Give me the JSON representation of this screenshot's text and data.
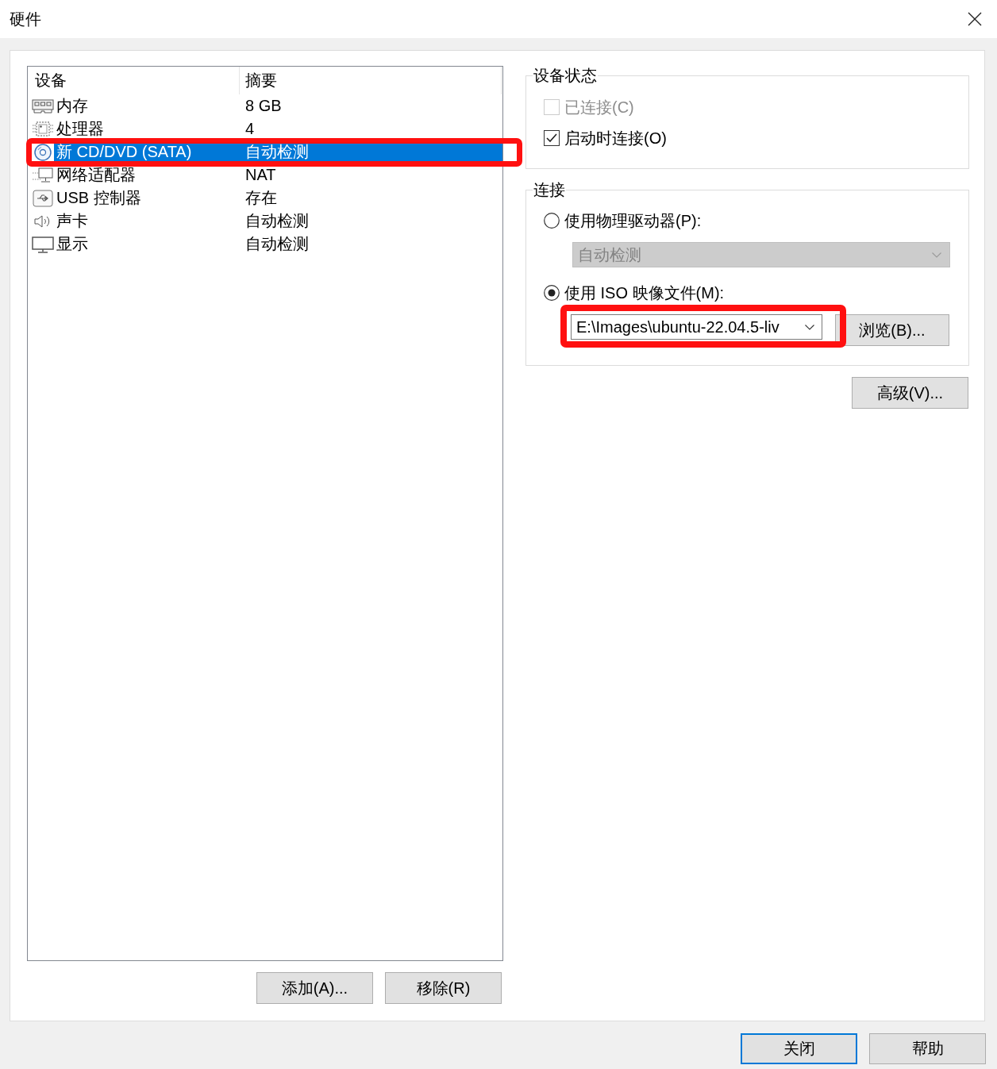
{
  "window": {
    "title": "硬件"
  },
  "device_list": {
    "columns": [
      "设备",
      "摘要"
    ],
    "items": [
      {
        "kind": "memory",
        "name": "内存",
        "summary": "8 GB",
        "selected": false,
        "highlighted": false
      },
      {
        "kind": "processor",
        "name": "处理器",
        "summary": "4",
        "selected": false,
        "highlighted": false
      },
      {
        "kind": "cd",
        "name": "新 CD/DVD (SATA)",
        "summary": "自动检测",
        "selected": true,
        "highlighted": true
      },
      {
        "kind": "network",
        "name": "网络适配器",
        "summary": "NAT",
        "selected": false,
        "highlighted": false
      },
      {
        "kind": "usb",
        "name": "USB 控制器",
        "summary": "存在",
        "selected": false,
        "highlighted": false
      },
      {
        "kind": "sound",
        "name": "声卡",
        "summary": "自动检测",
        "selected": false,
        "highlighted": false
      },
      {
        "kind": "display",
        "name": "显示",
        "summary": "自动检测",
        "selected": false,
        "highlighted": false
      }
    ]
  },
  "list_buttons": [
    "添加(A)...",
    "移除(R)"
  ],
  "device_status": {
    "title": "设备状态",
    "options": [
      {
        "label": "已连接(C)",
        "checked": false,
        "disabled": true
      },
      {
        "label": "启动时连接(O)",
        "checked": true,
        "disabled": false
      }
    ]
  },
  "connection": {
    "title": "连接",
    "options": [
      {
        "label": "使用物理驱动器(P):",
        "selected": false
      },
      {
        "label": "使用 ISO 映像文件(M):",
        "selected": true
      }
    ],
    "drive_dropdown": {
      "value": "自动检测",
      "disabled": true
    },
    "iso_path": {
      "value": "E:\\Images\\ubuntu-22.04.5-liv",
      "highlighted": true
    },
    "browse_button": "浏览(B)..."
  },
  "advanced_button": "高级(V)...",
  "footer_buttons": [
    {
      "label": "关闭",
      "default": true
    },
    {
      "label": "帮助",
      "default": false
    }
  ]
}
